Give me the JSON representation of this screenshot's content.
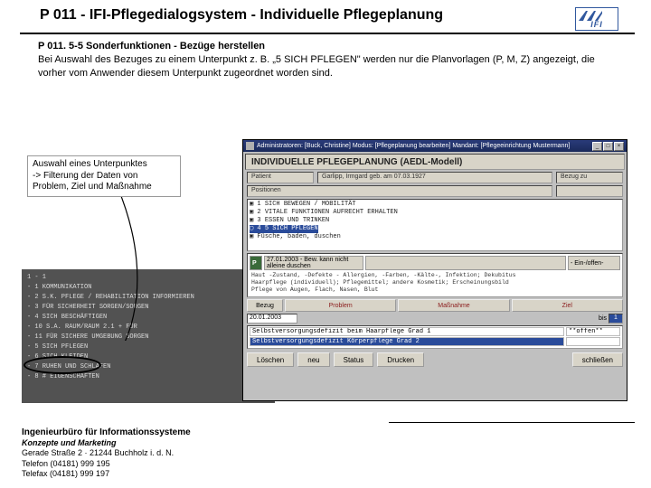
{
  "header": {
    "title": "P 011 - IFI-Pflegedialogsystem - Individuelle Pflegeplanung",
    "logo_text": "IFI"
  },
  "body": {
    "line1": "P 011. 5-5 Sonderfunktionen - Bezüge herstellen",
    "line2": "Bei Auswahl des Bezuges zu einem Unterpunkt z. B. „5 SICH PFLEGEN\" werden nur die Planvorlagen (P, M, Z) angezeigt, die vorher vom Anwender diesem Unterpunkt zugeordnet worden sind."
  },
  "callout": {
    "l1": "Auswahl eines Unterpunktes",
    "l2": "-> Filterung der Daten von Problem, Ziel und Maßnahme"
  },
  "screenshot": {
    "titlebar": "Administratoren: [Buck, Christine]  Modus: [Pflegeplanung bearbeiten]  Mandant: [Pflegeeinrichtung Mustermann]",
    "banner": "INDIVIDUELLE PFLEGEPLANUNG  (AEDL-Modell)",
    "patient_label": "Patient",
    "patient_value": "Garlipp, Irmgard geb. am 07.03.1927",
    "right_label": "Bezug zu",
    "tree_header": "Positionen",
    "tree": [
      "▣  1  SICH BEWEGEN / MOBILITÄT",
      "▣  2  VITALE FUNKTIONEN AUFRECHT ERHALTEN",
      "▣  3  ESSEN UND TRINKEN",
      "▢  4  5  SICH PFLEGEN",
      "   ▣  Füsche, baden, duschen"
    ],
    "p_letter": "P",
    "p_date": "27.01.2003  -  Bew. kann nicht alleine duschen",
    "p_sfx": "-  Ein-/offen-",
    "textlines": [
      "Haut -Zustand, -Defekte - Allergien, -Farben, -Kälte-, Infektion; Dekubitus",
      "Haarpflege (individuell); Pflegemittel; andere Kosmetik; Erscheinungsbild",
      "Pflege von Augen, Flach, Nasen, Blut"
    ],
    "tabs": {
      "first": "Bezug",
      "p": "Problem",
      "m": "Maßnahme",
      "z": "Ziel"
    },
    "after_tabs": {
      "date": "20.01.2003",
      "bis": "bis",
      "page": "1"
    },
    "lower": [
      {
        "a": "Selbstversorgungsdefizit beim Haarpflege Grad 1",
        "b": "**offen**"
      },
      {
        "a": "Selbstversorgungsdefizit Körperpflege Grad 2",
        "b": ""
      }
    ],
    "buttons": {
      "loeschen": "Löschen",
      "neu": "neu",
      "status": "Status",
      "drucken": "Drucken",
      "schliessen": "schließen"
    }
  },
  "dark_panel": [
    "1 - 1",
    "- 1  KOMMUNIKATION",
    "- 2  S.K. PFLEGE / REHABILITATION INFORMIEREN",
    "- 3  FÜR SICHERHEIT SORGEN/SORGEN",
    "- 4  SICH BESCHÄFTIGEN",
    "- 10 S.A. RAUM/RAUM 2.1 + FÜR",
    "- 11 FÜR SICHERE UMGEBUNG SORGEN",
    "   - 5  SICH PFLEGEN",
    "- 6  SICH KLEIDEN",
    "- 7  RUHEN UND SCHLAFEN",
    "- 8  # EIGENSCHAFTEN"
  ],
  "footer": {
    "l1": "Ingenieurbüro für Informationssysteme",
    "l2": "Konzepte und Marketing",
    "l3": "Gerade Straße 2 · 21244 Buchholz i. d. N.",
    "l4": "Telefon (04181) 999 195",
    "l5": "Telefax (04181) 999 197"
  }
}
